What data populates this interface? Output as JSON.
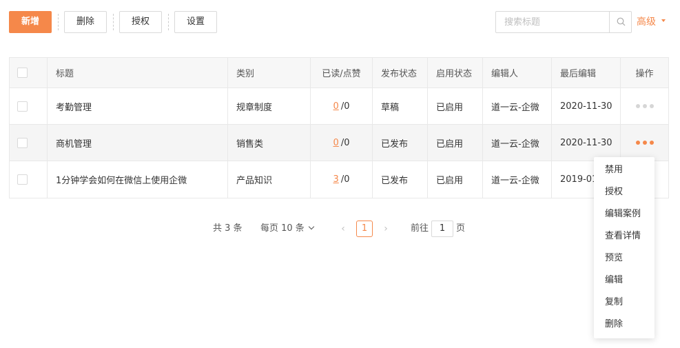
{
  "toolbar": {
    "add_label": "新增",
    "delete_label": "删除",
    "authorize_label": "授权",
    "settings_label": "设置",
    "search_placeholder": "搜索标题",
    "advanced_label": "高级"
  },
  "table": {
    "headers": [
      "标题",
      "类别",
      "已读/点赞",
      "发布状态",
      "启用状态",
      "编辑人",
      "最后编辑",
      "操作"
    ],
    "rows": [
      {
        "title": "考勤管理",
        "category": "规章制度",
        "read": "0",
        "likes": "/0",
        "publish": "草稿",
        "enabled": "已启用",
        "editor": "道一云-企微",
        "last_edit": "2020-11-30"
      },
      {
        "title": "商机管理",
        "category": "销售类",
        "read": "0",
        "likes": "/0",
        "publish": "已发布",
        "enabled": "已启用",
        "editor": "道一云-企微",
        "last_edit": "2020-11-30"
      },
      {
        "title": "1分钟学会如何在微信上使用企微",
        "category": "产品知识",
        "read": "3",
        "likes": "/0",
        "publish": "已发布",
        "enabled": "已启用",
        "editor": "道一云-企微",
        "last_edit": "2019-01-"
      }
    ]
  },
  "pagination": {
    "total": "共 3 条",
    "page_size": "每页 10 条",
    "prev": "‹",
    "next": "›",
    "current_page": "1",
    "goto_prefix": "前往",
    "goto_value": "1",
    "goto_suffix": "页"
  },
  "action_menu": {
    "items": [
      "禁用",
      "授权",
      "编辑案例",
      "查看详情",
      "预览",
      "编辑",
      "复制",
      "删除"
    ]
  },
  "colors": {
    "accent": "#f5884a",
    "border": "#e8e8e8",
    "header_bg": "#f7f7f7"
  }
}
